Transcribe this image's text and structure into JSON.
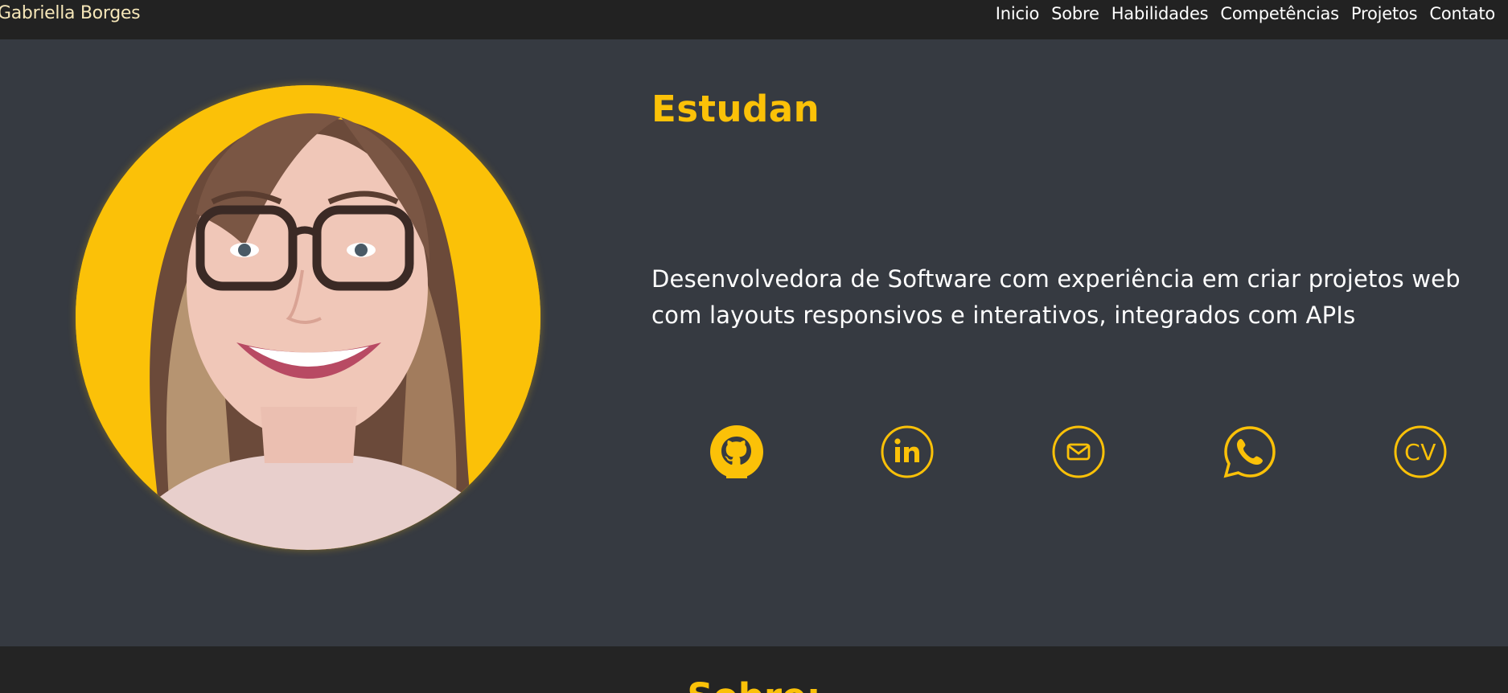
{
  "header": {
    "brand": "Gabriella Borges",
    "nav": [
      "Inicio",
      "Sobre",
      "Habilidades",
      "Competências",
      "Projetos",
      "Contato"
    ]
  },
  "hero": {
    "title": "Estudan",
    "description": "Desenvolvedora de Software com experiência em criar projetos web com layouts responsivos e interativos, integrados com APIs",
    "social": [
      {
        "icon": "github-icon"
      },
      {
        "icon": "linkedin-icon"
      },
      {
        "icon": "email-icon"
      },
      {
        "icon": "whatsapp-icon"
      },
      {
        "icon": "cv-icon",
        "label": "CV"
      }
    ]
  },
  "about": {
    "title": "Sobre:"
  },
  "colors": {
    "accent": "#fbc108",
    "background": "#363a41",
    "navbar": "#222222"
  }
}
